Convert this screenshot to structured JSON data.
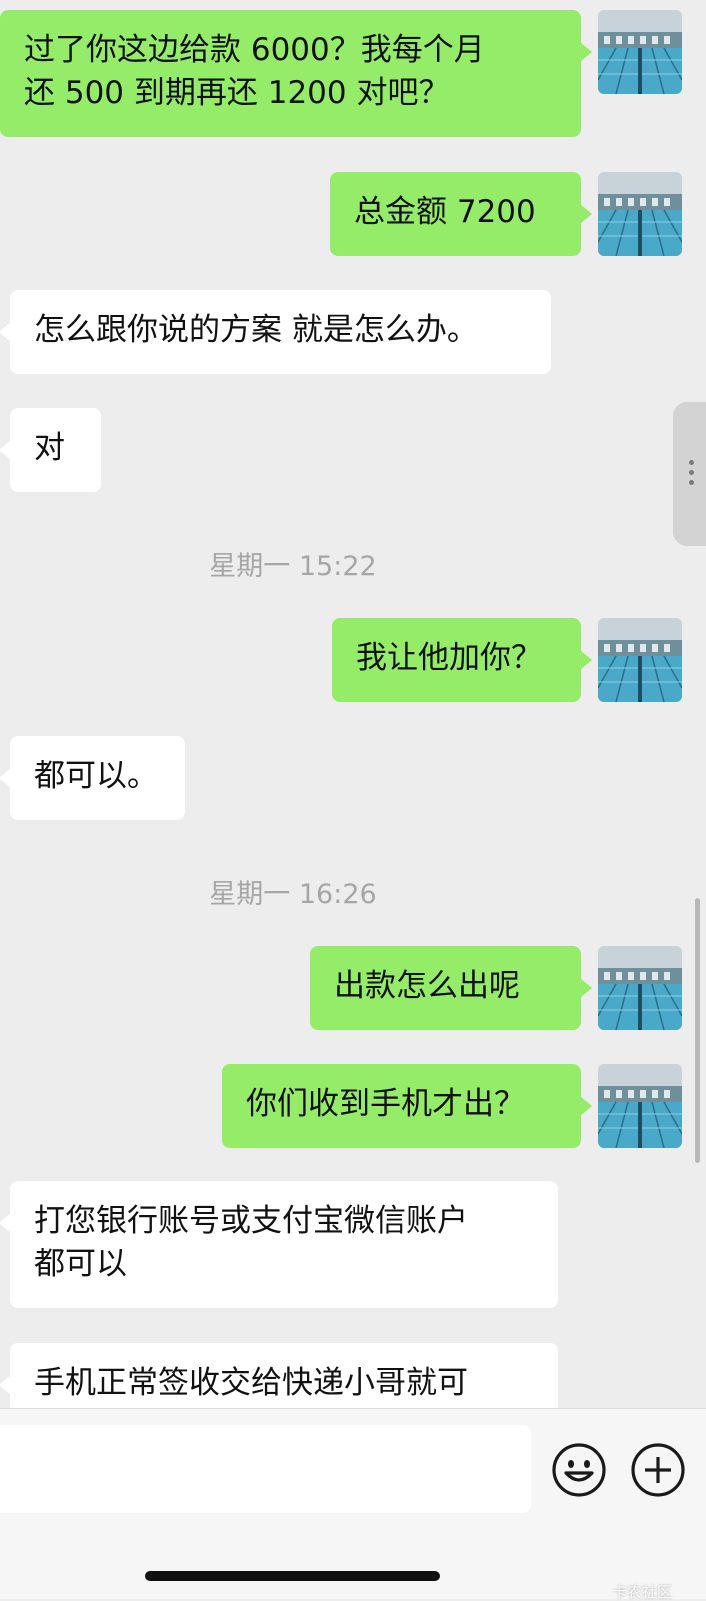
{
  "messages": [
    {
      "from": "me",
      "lines": [
        "过了你这边给款 6000？我每个月",
        "还 500 到期再还 1200 对吧？"
      ]
    },
    {
      "from": "me",
      "lines": [
        "总金额 7200"
      ]
    },
    {
      "from": "them",
      "lines": [
        "怎么跟你说的方案 就是怎么办。"
      ]
    },
    {
      "from": "them",
      "lines": [
        "对"
      ]
    },
    {
      "time": "星期一 15:22"
    },
    {
      "from": "me",
      "lines": [
        "我让他加你？"
      ]
    },
    {
      "from": "them",
      "lines": [
        "都可以。"
      ]
    },
    {
      "time": "星期一 16:26"
    },
    {
      "from": "me",
      "lines": [
        "出款怎么出呢"
      ]
    },
    {
      "from": "me",
      "lines": [
        "你们收到手机才出？"
      ]
    },
    {
      "from": "them",
      "lines": [
        "打您银行账号或支付宝微信账户",
        "都可以"
      ]
    },
    {
      "from": "them",
      "lines": [
        "手机正常签收交给快递小哥就可"
      ]
    }
  ],
  "input": {
    "value": "",
    "placeholder": ""
  },
  "icons": {
    "emoji": "emoji-face-icon",
    "add": "plus-circle-icon",
    "side_handle": "vertical-dots-icon"
  },
  "colors": {
    "sent_bubble": "#95ec69",
    "received_bubble": "#ffffff",
    "background": "#ededed",
    "timestamp": "#a6a6a6"
  },
  "watermark": "卡农社区"
}
